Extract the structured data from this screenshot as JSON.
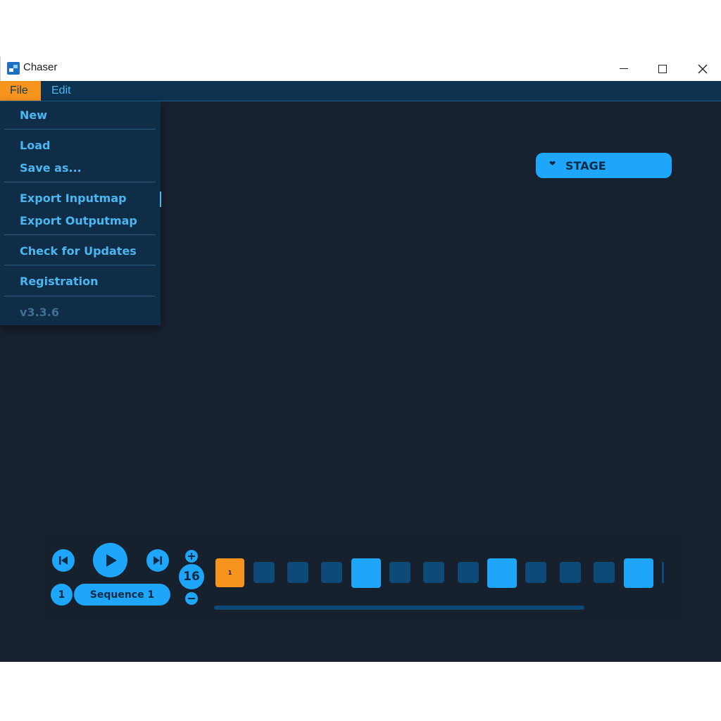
{
  "window": {
    "title": "Chaser"
  },
  "menubar": {
    "items": [
      {
        "label": "File"
      },
      {
        "label": "Edit"
      }
    ]
  },
  "file_menu": {
    "items": [
      {
        "label": "New"
      },
      {
        "label": "Load"
      },
      {
        "label": "Save as..."
      },
      {
        "label": "Export Inputmap"
      },
      {
        "label": "Export Outputmap"
      },
      {
        "label": "Check for Updates"
      },
      {
        "label": "Registration"
      }
    ],
    "version": "v3.3.6"
  },
  "stage": {
    "label": "STAGE",
    "icon": "heart-icon"
  },
  "transport": {
    "sequence_number": "1",
    "sequence_name": "Sequence 1",
    "step_count": "16",
    "active_step_label": "1",
    "progress": 0.0
  },
  "colors": {
    "accent": "#1ea7fa",
    "highlight": "#f7941d",
    "background": "#18212f",
    "menu_bg": "#0f2d46",
    "step_dim": "#0d4a78"
  }
}
